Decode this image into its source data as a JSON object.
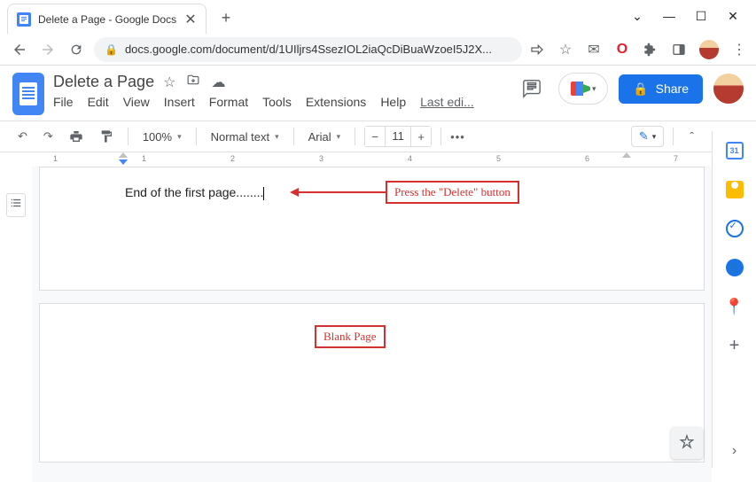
{
  "browser": {
    "tab_title": "Delete a Page - Google Docs",
    "url": "docs.google.com/document/d/1UIljrs4SsezIOL2iaQcDiBuaWzoeI5J2X..."
  },
  "docs": {
    "title": "Delete a Page",
    "menus": {
      "file": "File",
      "edit": "Edit",
      "view": "View",
      "insert": "Insert",
      "format": "Format",
      "tools": "Tools",
      "extensions": "Extensions",
      "help": "Help"
    },
    "last_edit": "Last edi...",
    "share_label": "Share"
  },
  "toolbar": {
    "zoom": "100%",
    "style": "Normal text",
    "font": "Arial",
    "font_size": "11"
  },
  "document": {
    "page1_text": "End of the first page........"
  },
  "annotations": {
    "delete_hint": "Press the \"Delete\" button",
    "blank_page": "Blank Page"
  },
  "sidepanel": {
    "calendar_day": "31"
  }
}
